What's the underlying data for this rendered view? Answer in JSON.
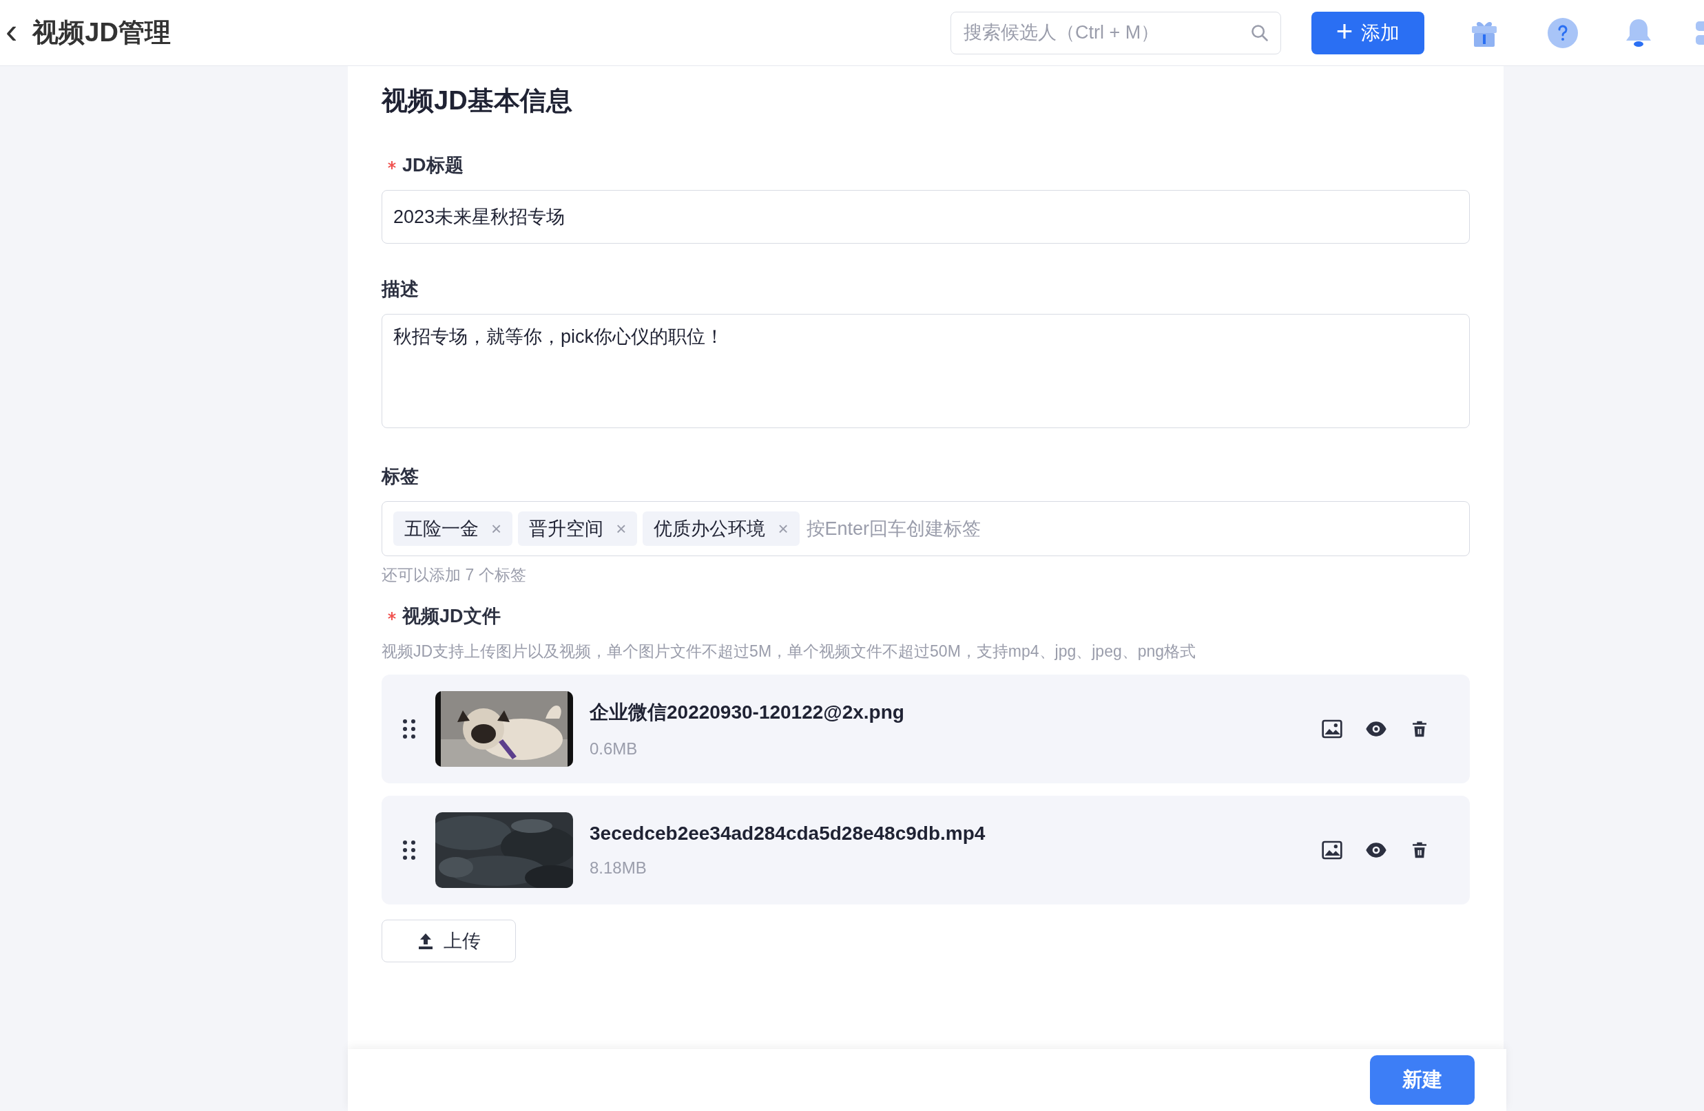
{
  "header": {
    "back_icon": "‹",
    "title": "视频JD管理",
    "search": {
      "placeholder": "搜索候选人（Ctrl + M）"
    },
    "add_button": {
      "icon": "+",
      "label": "添加"
    }
  },
  "form": {
    "title": "视频JD基本信息",
    "fields": [
      {
        "kind": "input",
        "label": "JD标题",
        "required": true,
        "value": "2023未来星秋招专场"
      },
      {
        "kind": "textarea",
        "label": "描述",
        "required": false,
        "value": "秋招专场，就等你，pick你心仪的职位！"
      },
      {
        "kind": "tags",
        "label": "标签",
        "required": false,
        "tags": [
          "五险一金",
          "晋升空间",
          "优质办公环境"
        ],
        "remove_icon": "×",
        "placeholder": "按Enter回车创建标签",
        "hint": "还可以添加 7 个标签"
      }
    ],
    "files_section": {
      "label": "视频JD文件",
      "required": true,
      "hint": "视频JD支持上传图片以及视频，单个图片文件不超过5M，单个视频文件不超过50M，支持mp4、jpg、jpeg、png格式",
      "files": [
        {
          "kind": "picture",
          "name": "企业微信20220930-120122@2x.png",
          "size": "0.6MB"
        },
        {
          "kind": "picture",
          "name": "3ecedceb2ee34ad284cda5d28e48c9db.mp4",
          "size": "8.18MB"
        }
      ],
      "upload_button": "上传"
    }
  },
  "footer": {
    "submit_button": "新建"
  }
}
